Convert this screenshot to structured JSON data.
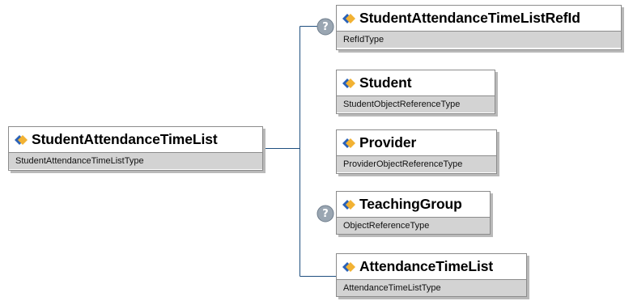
{
  "root": {
    "name": "StudentAttendanceTimeList",
    "type": "StudentAttendanceTimeListType"
  },
  "children": [
    {
      "name": "StudentAttendanceTimeListRefId",
      "type": "RefIdType",
      "optional": true
    },
    {
      "name": "Student",
      "type": "StudentObjectReferenceType",
      "optional": false
    },
    {
      "name": "Provider",
      "type": "ProviderObjectReferenceType",
      "optional": false
    },
    {
      "name": "TeachingGroup",
      "type": "ObjectReferenceType",
      "optional": true
    },
    {
      "name": "AttendanceTimeList",
      "type": "AttendanceTimeListType",
      "optional": false
    }
  ],
  "optional_marker": "?",
  "colors": {
    "connector": "#1f4f7f",
    "type_band": "#d3d3d3",
    "border": "#8c8c8c",
    "shadow": "#b9b9b9",
    "badge": "#9aa6b2"
  },
  "icons": {
    "element": "element-diamond-icon",
    "optional": "optional-question-icon"
  }
}
